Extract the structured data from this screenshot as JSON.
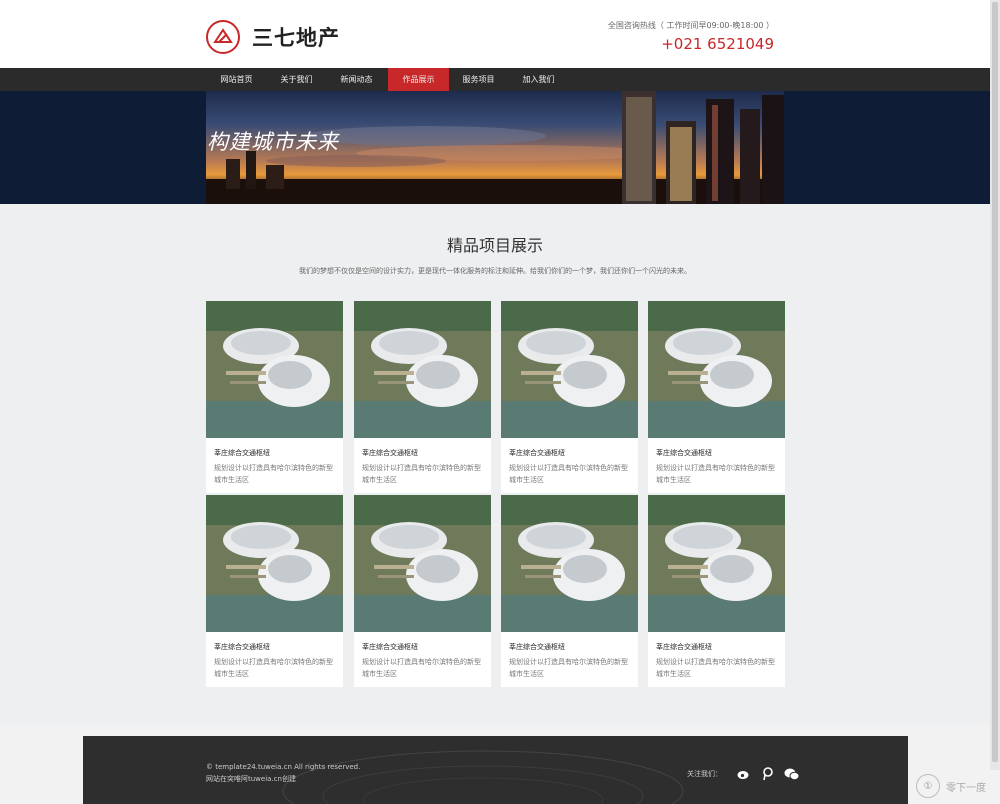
{
  "brand": {
    "name": "三七地产"
  },
  "contact": {
    "label": "全国咨询热线（ 工作时间早09:00-晚18:00 ）",
    "phone": "+021 6521049"
  },
  "nav": {
    "items": [
      {
        "label": "网站首页"
      },
      {
        "label": "关于我们"
      },
      {
        "label": "新闻动态"
      },
      {
        "label": "作品展示",
        "active": true
      },
      {
        "label": "服务项目"
      },
      {
        "label": "加入我们"
      }
    ]
  },
  "banner": {
    "title": "构建城市未来"
  },
  "section": {
    "title": "精品项目展示",
    "description": "我们的梦想不仅仅是空间的设计实力，更是现代一体化服务的标注和延伸。给我们你们的一个梦，我们还你们一个闪光的未来。"
  },
  "projects": [
    {
      "title": "莘庄综合交通枢纽",
      "desc": "规划设计以打造具有哈尔滨特色的新型城市生活区"
    },
    {
      "title": "莘庄综合交通枢纽",
      "desc": "规划设计以打造具有哈尔滨特色的新型城市生活区"
    },
    {
      "title": "莘庄综合交通枢纽",
      "desc": "规划设计以打造具有哈尔滨特色的新型城市生活区"
    },
    {
      "title": "莘庄综合交通枢纽",
      "desc": "规划设计以打造具有哈尔滨特色的新型城市生活区"
    },
    {
      "title": "莘庄综合交通枢纽",
      "desc": "规划设计以打造具有哈尔滨特色的新型城市生活区"
    },
    {
      "title": "莘庄综合交通枢纽",
      "desc": "规划设计以打造具有哈尔滨特色的新型城市生活区"
    },
    {
      "title": "莘庄综合交通枢纽",
      "desc": "规划设计以打造具有哈尔滨特色的新型城市生活区"
    },
    {
      "title": "莘庄综合交通枢纽",
      "desc": "规划设计以打造具有哈尔滨特色的新型城市生活区"
    }
  ],
  "footer": {
    "copyright": "© template24.tuweia.cn All rights reserved.",
    "credit": "网站在突唯阿tuweia.cn创建",
    "follow_label": "关注我们：",
    "social": [
      {
        "icon": "weibo-icon"
      },
      {
        "icon": "tencent-weibo-icon"
      },
      {
        "icon": "wechat-icon"
      }
    ]
  },
  "watermark": {
    "text": "零下一度"
  },
  "colors": {
    "accent": "#c8282a",
    "nav_bg": "#2b2b2b",
    "banner_bg": "#0f1c35",
    "footer_bg": "#2e2e2e"
  }
}
